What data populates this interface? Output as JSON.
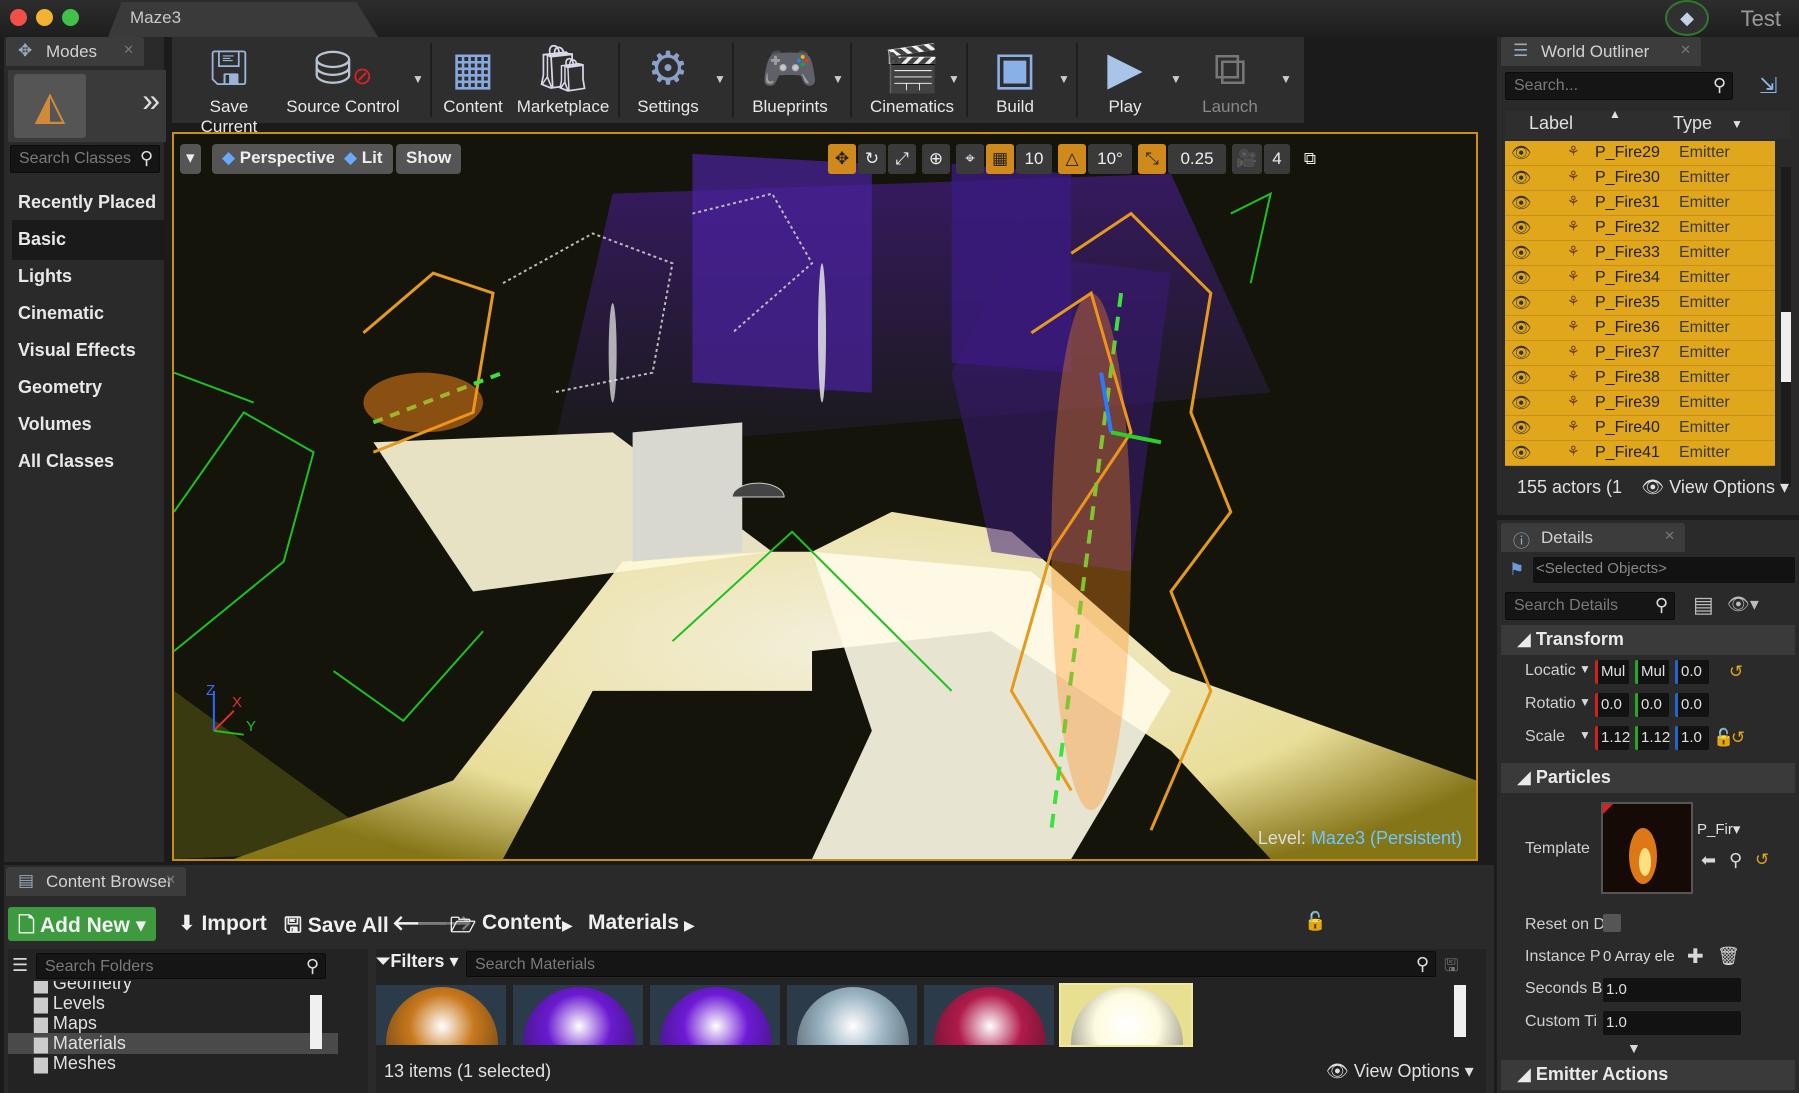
{
  "window": {
    "tab_title": "Maze3",
    "user_label": "Test"
  },
  "modes": {
    "tab_label": "Modes",
    "search_placeholder": "Search Classes",
    "items": [
      "Recently Placed",
      "Basic",
      "Lights",
      "Cinematic",
      "Visual Effects",
      "Geometry",
      "Volumes",
      "All Classes"
    ],
    "active_index": 1
  },
  "toolbar": {
    "buttons": [
      {
        "label": "Save Current",
        "icon": "floppy-icon"
      },
      {
        "label": "Source Control",
        "icon": "source-control-icon"
      },
      {
        "label": "Content",
        "icon": "content-grid-icon"
      },
      {
        "label": "Marketplace",
        "icon": "marketplace-bag-icon"
      },
      {
        "label": "Settings",
        "icon": "gear-icon"
      },
      {
        "label": "Blueprints",
        "icon": "gamepad-icon"
      },
      {
        "label": "Cinematics",
        "icon": "clapper-icon"
      },
      {
        "label": "Build",
        "icon": "build-blocks-icon"
      },
      {
        "label": "Play",
        "icon": "play-icon"
      },
      {
        "label": "Launch",
        "icon": "launch-icon"
      }
    ]
  },
  "viewport": {
    "perspective_label": "Perspective",
    "lit_label": "Lit",
    "show_label": "Show",
    "grid_snap": "10",
    "rotation_snap": "10°",
    "scale_snap": "0.25",
    "camera_speed": "4",
    "level_prefix": "Level:",
    "level_name": "Maze3 (Persistent)",
    "axis_labels": {
      "z": "Z",
      "x": "X",
      "y": "Y"
    }
  },
  "outliner": {
    "tab_label": "World Outliner",
    "search_placeholder": "Search...",
    "col_label": "Label",
    "col_type": "Type",
    "rows": [
      {
        "label": "P_Fire29",
        "type": "Emitter"
      },
      {
        "label": "P_Fire30",
        "type": "Emitter"
      },
      {
        "label": "P_Fire31",
        "type": "Emitter"
      },
      {
        "label": "P_Fire32",
        "type": "Emitter"
      },
      {
        "label": "P_Fire33",
        "type": "Emitter"
      },
      {
        "label": "P_Fire34",
        "type": "Emitter"
      },
      {
        "label": "P_Fire35",
        "type": "Emitter"
      },
      {
        "label": "P_Fire36",
        "type": "Emitter"
      },
      {
        "label": "P_Fire37",
        "type": "Emitter"
      },
      {
        "label": "P_Fire38",
        "type": "Emitter"
      },
      {
        "label": "P_Fire39",
        "type": "Emitter"
      },
      {
        "label": "P_Fire40",
        "type": "Emitter"
      },
      {
        "label": "P_Fire41",
        "type": "Emitter"
      }
    ],
    "footer_count": "155 actors (1",
    "view_options": "View Options"
  },
  "details": {
    "tab_label": "Details",
    "selected_objects": "<Selected Objects>",
    "search_placeholder": "Search Details",
    "transform_header": "Transform",
    "location_label": "Locatic",
    "location_values": [
      "Mul",
      "Mul",
      "0.0"
    ],
    "rotation_label": "Rotatio",
    "rotation_values": [
      "0.0",
      "0.0",
      "0.0"
    ],
    "scale_label": "Scale",
    "scale_values": [
      "1.12",
      "1.12",
      "1.0"
    ],
    "particles_header": "Particles",
    "template_label": "Template",
    "template_value": "P_Fir",
    "reset_label": "Reset on D",
    "instance_label": "Instance P",
    "instance_value": "0 Array ele",
    "seconds_label": "Seconds B",
    "seconds_value": "1.0",
    "custom_label": "Custom Ti",
    "custom_value": "1.0",
    "emitter_actions_header": "Emitter Actions"
  },
  "content_browser": {
    "tab_label": "Content Browser",
    "add_new": "Add New",
    "import": "Import",
    "save_all": "Save All",
    "breadcrumb": [
      "Content",
      "Materials"
    ],
    "folder_search_placeholder": "Search Folders",
    "folders": [
      "Geometry",
      "Levels",
      "Maps",
      "Materials",
      "Meshes"
    ],
    "selected_folder_index": 3,
    "filters_label": "Filters",
    "asset_search_placeholder": "Search Materials",
    "status": "13 items (1 selected)",
    "view_options": "View Options",
    "thumb_colors": [
      "#c8781c",
      "#6a1ad0",
      "#6d1ad6",
      "#9ab3c2",
      "#b01a4a",
      "#fffbe0"
    ]
  },
  "colors": {
    "selection": "#e0a61c",
    "add_new": "#3e9a3e",
    "viewport_border": "#c98e12",
    "level_name": "#6ec6ff"
  }
}
